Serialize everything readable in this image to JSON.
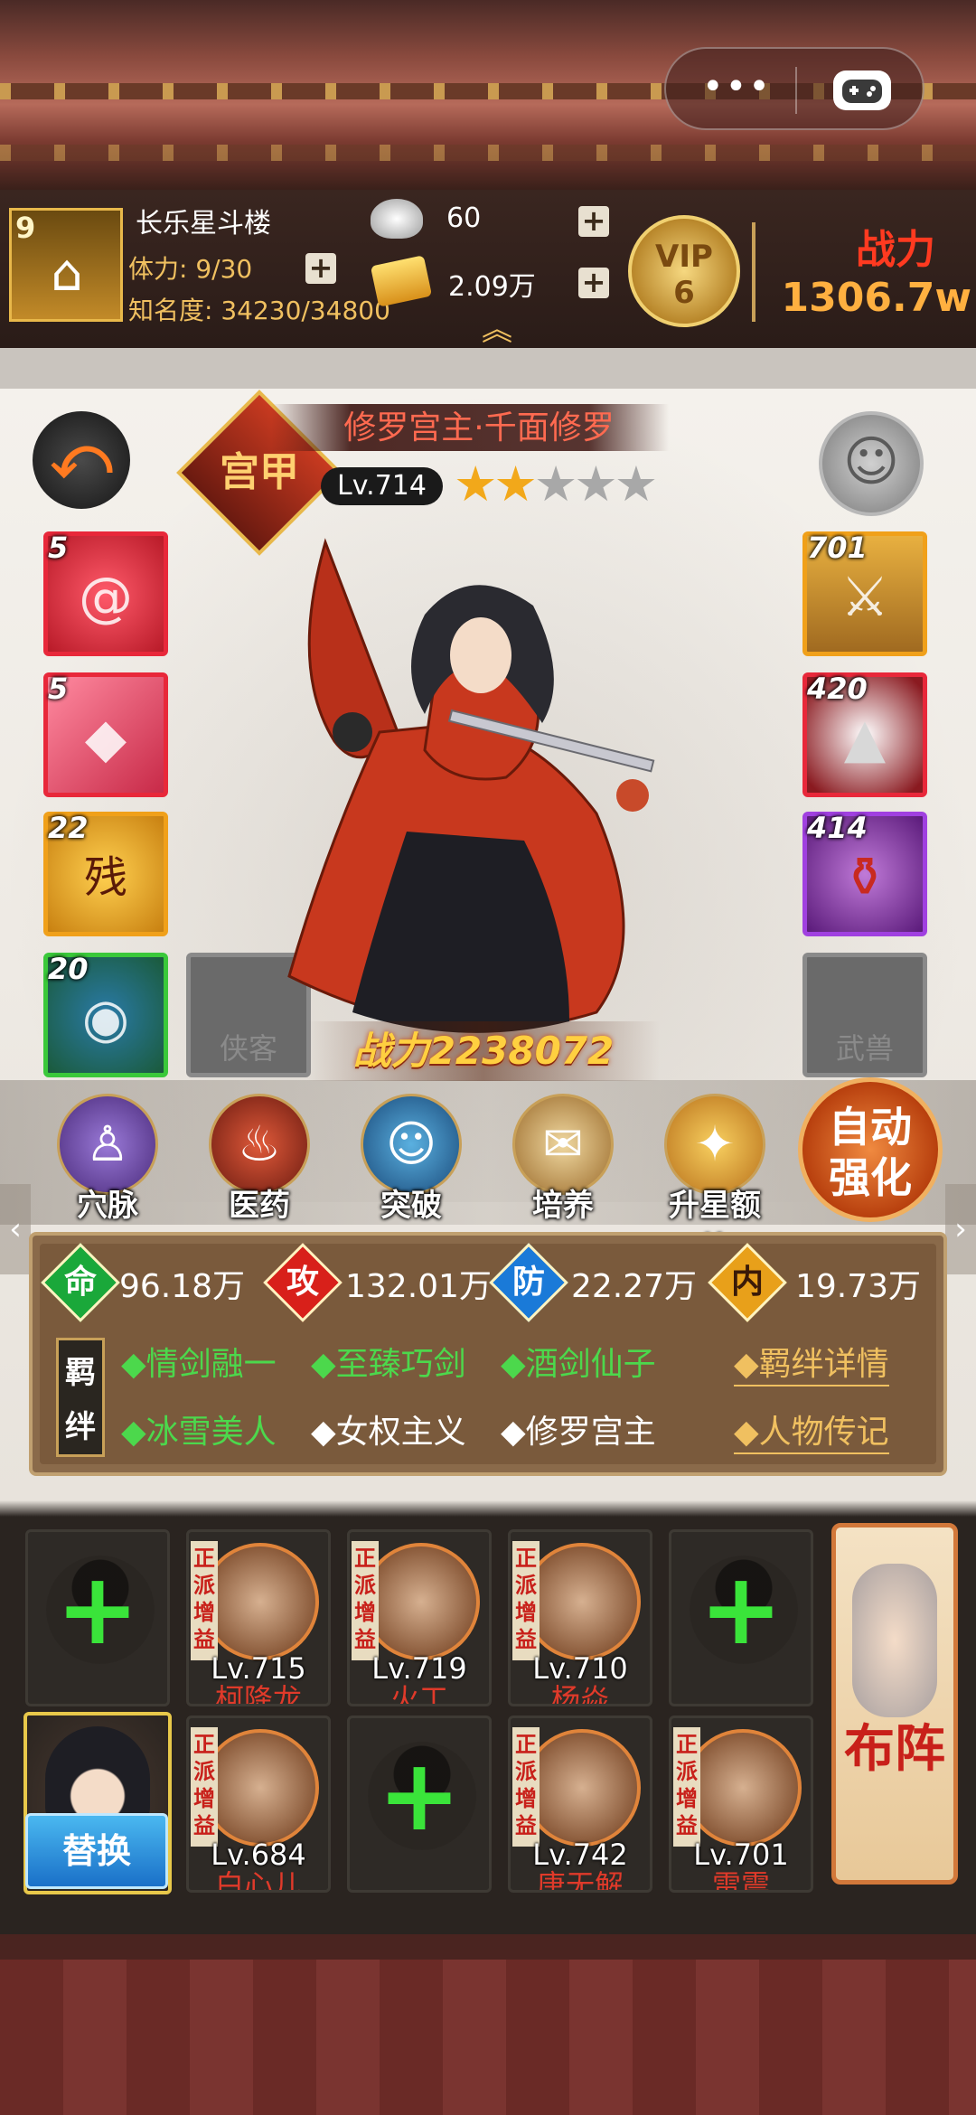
{
  "header": {
    "menu_dots": "•••",
    "building_level": "9",
    "building_name": "长乐星斗楼",
    "stamina": "体力: 9/30",
    "fame": "知名度: 34230/34800",
    "silver": "60",
    "gold": "2.09万",
    "vip_label": "VIP",
    "vip_level": "6",
    "power_label": "战力",
    "power_value": "1306.7w"
  },
  "hero": {
    "badge": "宫甲",
    "name": "修罗宫主·千面修罗",
    "level": "Lv.714",
    "stars_filled": 2,
    "stars_total": 5,
    "power": "战力2238072"
  },
  "left_slots": [
    {
      "count": "5",
      "color": "#e8283a",
      "bg": "#b81a28"
    },
    {
      "count": "5",
      "color": "#e8283a",
      "bg": "#c82a48"
    },
    {
      "count": "22",
      "color": "#f0a01a",
      "bg": "#c88010",
      "glyph": "残"
    },
    {
      "count": "20",
      "color": "#3ac83a",
      "bg": "#1a5a3a"
    }
  ],
  "right_slots": [
    {
      "count": "701",
      "color": "#f0a01a",
      "bg": "#a06a20"
    },
    {
      "count": "420",
      "color": "#e8283a",
      "bg": "#8a1a20"
    },
    {
      "count": "414",
      "color": "#a040e0",
      "bg": "#5a1a7a"
    }
  ],
  "empty_slots": {
    "xiake": "侠客",
    "wushou": "武兽"
  },
  "actions": [
    "穴脉",
    "医药",
    "突破",
    "培养",
    "升星额外"
  ],
  "auto_strengthen": {
    "line1": "自动",
    "line2": "强化"
  },
  "stats": [
    {
      "label": "命",
      "value": "96.18万",
      "color": "#1aa83a"
    },
    {
      "label": "攻",
      "value": "132.01万",
      "color": "#d8201a"
    },
    {
      "label": "防",
      "value": "22.27万",
      "color": "#1a7ad8"
    },
    {
      "label": "内",
      "value": "19.73万",
      "color": "#e8a01a"
    }
  ],
  "bond_tag": "羁绊",
  "bonds_row1": [
    "◆情剑融一",
    "◆至臻巧剑",
    "◆酒剑仙子"
  ],
  "bonds_row2": [
    {
      "text": "◆冰雪美人",
      "active": true
    },
    {
      "text": "◆女权主义",
      "active": false
    },
    {
      "text": "◆修罗宫主",
      "active": false
    }
  ],
  "links": {
    "bond_detail": "◆羁绊详情",
    "biography": "◆人物传记"
  },
  "team_row1": [
    {
      "empty": true
    },
    {
      "tag": "正派增益",
      "level": "Lv.715",
      "name": "柯降龙"
    },
    {
      "tag": "正派增益",
      "level": "Lv.719",
      "name": "火工"
    },
    {
      "tag": "正派增益",
      "level": "Lv.710",
      "name": "杨焱"
    },
    {
      "empty": true
    }
  ],
  "team_row2": [
    {
      "tag": "正派增益",
      "level": "Lv.684",
      "name": "白心儿"
    },
    {
      "empty": true
    },
    {
      "tag": "正派增益",
      "level": "Lv.742",
      "name": "唐无解"
    },
    {
      "tag": "正派增益",
      "level": "Lv.701",
      "name": "雷震"
    }
  ],
  "swap_label": "替换",
  "formation": "布阵"
}
